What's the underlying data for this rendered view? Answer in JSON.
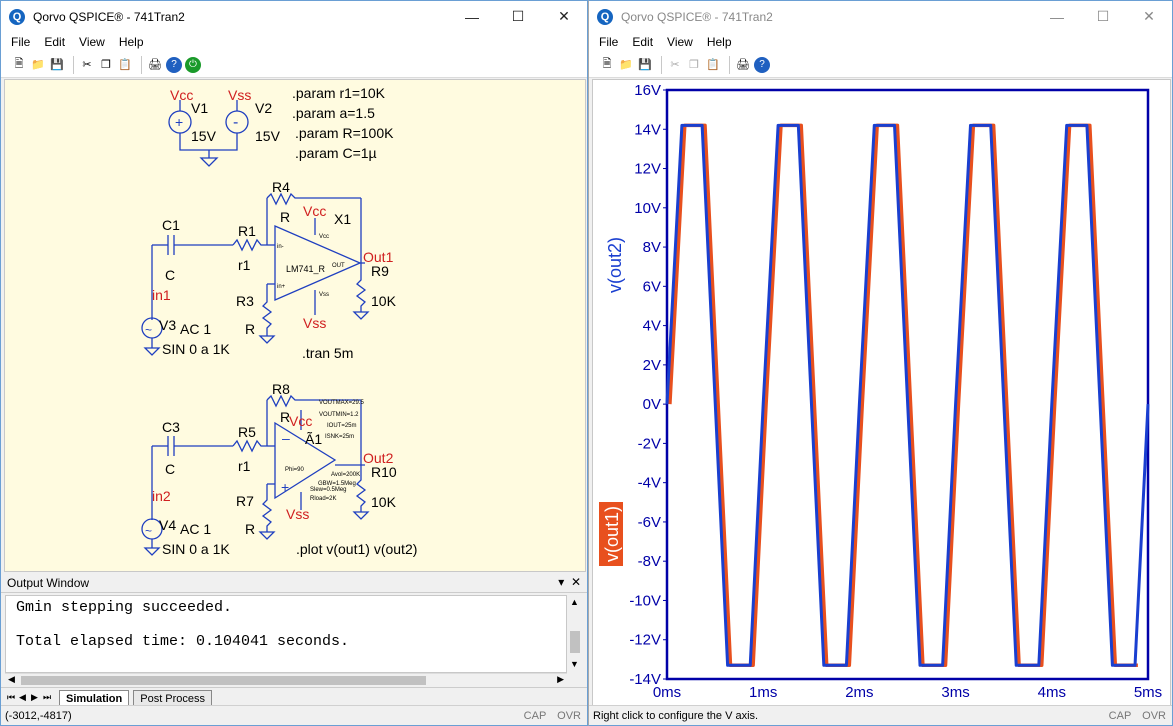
{
  "left_window": {
    "title": "Qorvo QSPICE® - 741Tran2",
    "menu": [
      "File",
      "Edit",
      "View",
      "Help"
    ],
    "schematic": {
      "params": [
        ".param r1=10K",
        ".param a=1.5",
        ".param R=100K",
        ".param C=1µ"
      ],
      "sources": {
        "v1_name": "V1",
        "v1_value": "15V",
        "v1_net": "Vcc",
        "v2_name": "V2",
        "v2_value": "15V",
        "v2_net": "Vss"
      },
      "circuit1": {
        "c_name": "C1",
        "c_value": "C",
        "r_in_name": "R1",
        "r_in_value": "r1",
        "r_fb_name": "R4",
        "r_fb_value": "R",
        "r_gnd_name": "R3",
        "r_gnd_value": "R",
        "r_load_name": "R9",
        "r_load_value": "10K",
        "opamp_name": "X1",
        "opamp_model": "LM741_R",
        "pin_in_minus": "in-",
        "pin_in_plus": "in+",
        "pin_out": "OUT",
        "pin_vcc": "Vcc",
        "pin_vss": "Vss",
        "net_vcc": "Vcc",
        "net_vss": "Vss",
        "net_out": "Out1",
        "net_in": "in1",
        "src_name": "V3",
        "src_ac": "AC 1",
        "src_sin": "SIN 0 a 1K",
        "directive": ".tran 5m"
      },
      "circuit2": {
        "c_name": "C3",
        "c_value": "C",
        "r_in_name": "R5",
        "r_in_value": "r1",
        "r_fb_name": "R8",
        "r_fb_value": "R",
        "r_gnd_name": "R7",
        "r_gnd_value": "R",
        "r_load_name": "R10",
        "r_load_value": "10K",
        "opamp_name": "Ã1",
        "params": [
          "VOUTMAX=29.5",
          "VOUTMIN=1.2",
          "IOUT=25m",
          "ISNK=25m"
        ],
        "phase": "Phi=90",
        "specs": [
          "Avol=200K",
          "GBW=1.5Meg",
          "Slew=0.5Meg",
          "Rload=2K"
        ],
        "net_vcc": "Vcc",
        "net_vss": "Vss",
        "net_out": "Out2",
        "net_in": "in2",
        "src_name": "V4",
        "src_ac": "AC 1",
        "src_sin": "SIN 0 a 1K",
        "directive": ".plot v(out1) v(out2)"
      }
    },
    "output_window": {
      "title": "Output Window",
      "lines": [
        "Gmin stepping succeeded.",
        "Total elapsed time: 0.104041 seconds."
      ]
    },
    "tabs": [
      "Simulation",
      "Post Process"
    ],
    "status": {
      "coords": "(-3012,-4817)",
      "cap": "CAP",
      "ovr": "OVR"
    }
  },
  "right_window": {
    "title": "Qorvo QSPICE® - 741Tran2",
    "menu": [
      "File",
      "Edit",
      "View",
      "Help"
    ],
    "status": {
      "text": "Right click to configure the V axis.",
      "cap": "CAP",
      "ovr": "OVR"
    }
  },
  "colors": {
    "out1": "#e8501e",
    "out2": "#1a3fd0",
    "axis": "#0000a8",
    "schematic_bg": "#fffbe0",
    "wire": "#1f3fc0",
    "netlabel": "#d02020"
  },
  "chart_data": {
    "type": "line",
    "xlabel": "",
    "x_ticks": [
      "0ms",
      "1ms",
      "2ms",
      "3ms",
      "4ms",
      "5ms"
    ],
    "y_ticks": [
      "16V",
      "14V",
      "12V",
      "10V",
      "8V",
      "6V",
      "4V",
      "2V",
      "0V",
      "-2V",
      "-4V",
      "-6V",
      "-8V",
      "-10V",
      "-12V",
      "-14V"
    ],
    "xlim": [
      0,
      5
    ],
    "ylim": [
      -14,
      16
    ],
    "series": [
      {
        "name": "v(out2)",
        "color": "#1a3fd0",
        "high": 14.2,
        "low": -13.3,
        "frequency_khz": 1
      },
      {
        "name": "v(out1)",
        "color": "#e8501e",
        "high": 14.2,
        "low": -13.3,
        "frequency_khz": 1
      }
    ]
  }
}
